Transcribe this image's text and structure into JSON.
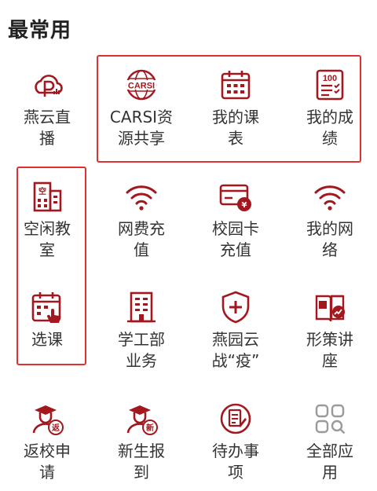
{
  "section_title": "最常用",
  "accent_color": "#a3181f",
  "highlight_color": "#e03131",
  "apps": [
    {
      "label": "燕云直\n播",
      "icon": "cloud-live-icon"
    },
    {
      "label": "CARSI资\n源共享",
      "icon": "carsi-globe-icon",
      "icon_text": "CARSI"
    },
    {
      "label": "我的课\n表",
      "icon": "calendar-icon"
    },
    {
      "label": "我的成\n绩",
      "icon": "score-sheet-icon",
      "icon_text": "100"
    },
    {
      "label": "空闲教\n室",
      "icon": "building-icon",
      "icon_text": "空"
    },
    {
      "label": "网费充\n值",
      "icon": "wifi-icon"
    },
    {
      "label": "校园卡\n充值",
      "icon": "campus-card-icon",
      "icon_text": "¥"
    },
    {
      "label": "我的网\n络",
      "icon": "wifi-icon"
    },
    {
      "label": "选课",
      "icon": "course-select-icon"
    },
    {
      "label": "学工部\n业务",
      "icon": "office-building-icon"
    },
    {
      "label": "燕园云\n战“疫”",
      "icon": "shield-plus-icon"
    },
    {
      "label": "形策讲\n座",
      "icon": "lecture-book-icon"
    },
    {
      "label": "返校申\n请",
      "icon": "return-student-icon",
      "icon_text": "返"
    },
    {
      "label": "新生报\n到",
      "icon": "new-student-icon",
      "icon_text": "新"
    },
    {
      "label": "待办事\n项",
      "icon": "todo-icon"
    },
    {
      "label": "全部应\n用",
      "icon": "all-apps-icon"
    }
  ]
}
